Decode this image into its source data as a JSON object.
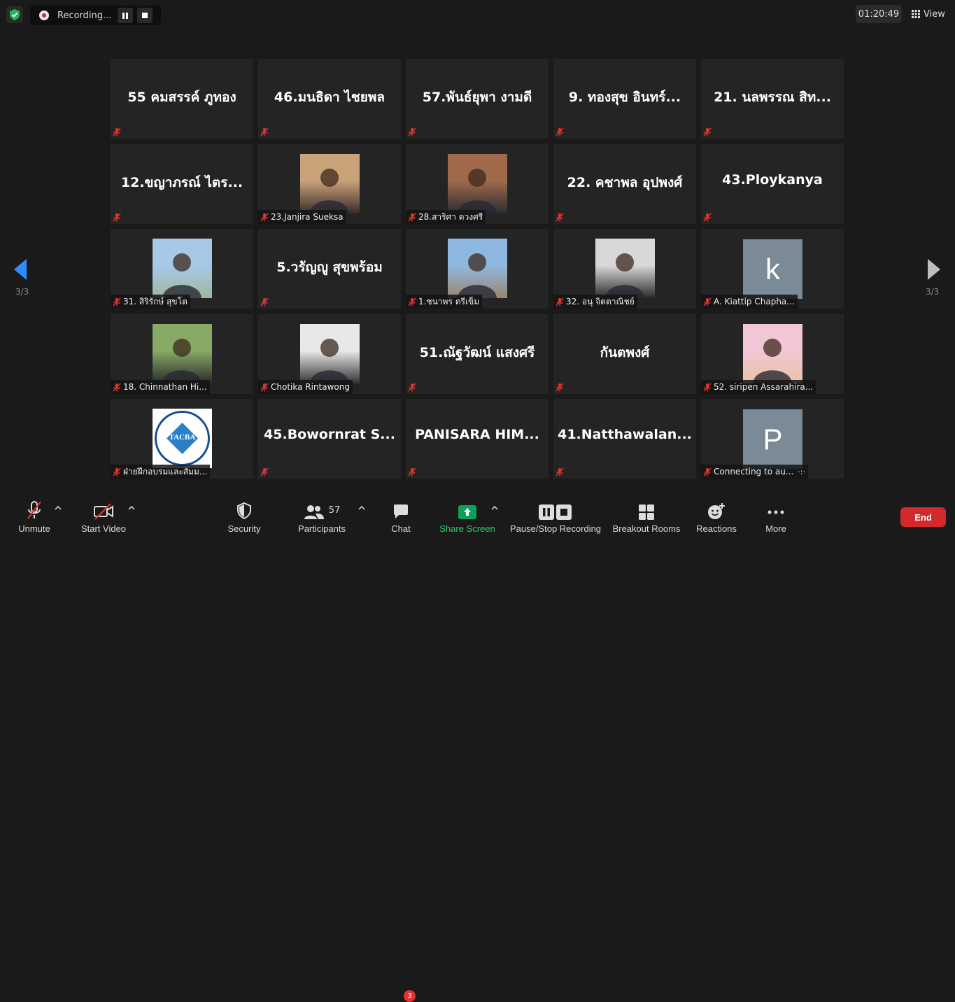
{
  "top": {
    "recording_label": "Recording...",
    "timer": "01:20:49",
    "view_label": "View"
  },
  "nav": {
    "page_left": "3/3",
    "page_right": "3/3"
  },
  "tiles": [
    {
      "name": "55 คมสรรค์ ภูทอง",
      "label": "",
      "kind": "text"
    },
    {
      "name": "46.มนธิดา  ไชยพล",
      "label": "",
      "kind": "text"
    },
    {
      "name": "57.พันธ์ยุพา งามดี",
      "label": "",
      "kind": "text"
    },
    {
      "name": "9. ทองสุข อินทร์...",
      "label": "",
      "kind": "text"
    },
    {
      "name": "21. นลพรรณ สิท...",
      "label": "",
      "kind": "text"
    },
    {
      "name": "12.ขญาภรณ์ ไตร...",
      "label": "",
      "kind": "text"
    },
    {
      "name": "",
      "label": "23.Janjira Sueksa",
      "kind": "video"
    },
    {
      "name": "",
      "label": "28.สาริศา ดวงศรี",
      "kind": "video"
    },
    {
      "name": "22. คชาพล อุปพงศ์",
      "label": "",
      "kind": "text"
    },
    {
      "name": "43.Ploykanya",
      "label": "",
      "kind": "text"
    },
    {
      "name": "",
      "label": "31. สิริรักษ์ สุขโต",
      "kind": "video"
    },
    {
      "name": "5.วรัญญู สุขพร้อม",
      "label": "",
      "kind": "text"
    },
    {
      "name": "",
      "label": "1.ชนาพร  ตรีเข็ม",
      "kind": "video"
    },
    {
      "name": "",
      "label": "32. อนุ จิตตาณิชย์",
      "kind": "video"
    },
    {
      "name": "k",
      "label": "A. Kiattip Chapha...",
      "kind": "letter"
    },
    {
      "name": "",
      "label": "18. Chinnathan Hi...",
      "kind": "video"
    },
    {
      "name": "",
      "label": "Chotika Rintawong",
      "kind": "video"
    },
    {
      "name": "51.ณัฐวัฒน์ แสงศรี",
      "label": "",
      "kind": "text"
    },
    {
      "name": "กันตพงศ์",
      "label": "",
      "kind": "text"
    },
    {
      "name": "",
      "label": "52. siripen Assarahira...",
      "kind": "video"
    },
    {
      "name": "",
      "label": "ฝ่ายฝึกอบรมและสัมม...",
      "kind": "logo",
      "logo_text": "TACBA"
    },
    {
      "name": "45.Bowornrat  S...",
      "label": "",
      "kind": "text"
    },
    {
      "name": "PANISARA  HIM...",
      "label": "",
      "kind": "text"
    },
    {
      "name": "41.Natthawalan...",
      "label": "",
      "kind": "text"
    },
    {
      "name": "P",
      "label": "Connecting to au...",
      "kind": "letter"
    }
  ],
  "toolbar": {
    "unmute": "Unmute",
    "start_video": "Start Video",
    "security": "Security",
    "participants": "Participants",
    "participants_count": "57",
    "chat": "Chat",
    "chat_badge": "3",
    "share_screen": "Share Screen",
    "pause_stop": "Pause/Stop Recording",
    "breakout": "Breakout Rooms",
    "reactions": "Reactions",
    "more": "More",
    "end": "End"
  },
  "colors": {
    "background": "#1a1a1a",
    "tile": "#242424",
    "share_green": "#0e9f5c",
    "end_red": "#d3292d",
    "nav_blue": "#2d8cff",
    "muted_red": "#e0342f"
  }
}
